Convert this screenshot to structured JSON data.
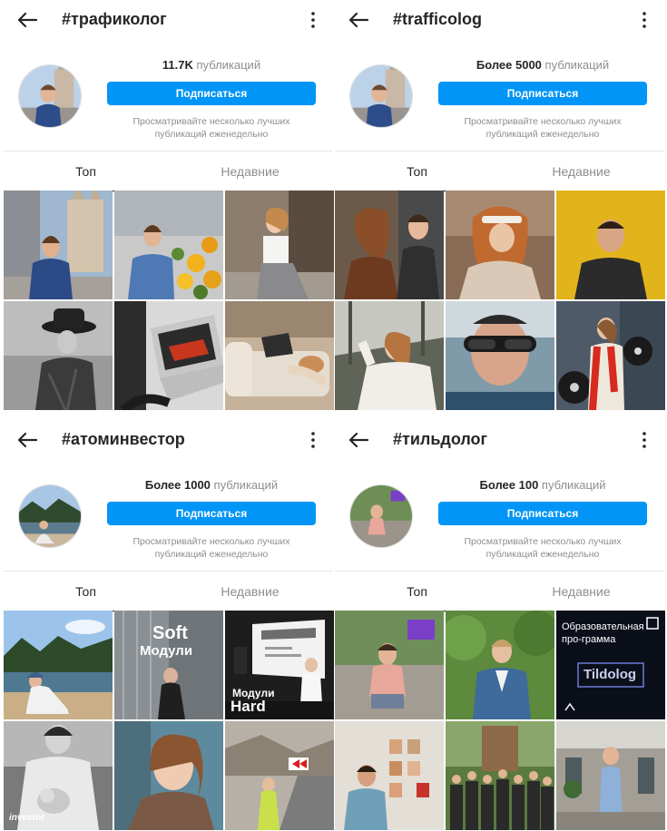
{
  "panels": [
    {
      "hashtag": "#трафиколог",
      "count_num": "11.7K",
      "count_label": "публикаций",
      "follow_label": "Подписаться",
      "desc_line1": "Просматривайте несколько лучших",
      "desc_line2": "публикаций еженедельно",
      "tab_top": "Топ",
      "tab_recent": "Недавние"
    },
    {
      "hashtag": "#trafficolog",
      "count_num": "Более 5000",
      "count_label": "публикаций",
      "follow_label": "Подписаться",
      "desc_line1": "Просматривайте несколько лучших",
      "desc_line2": "публикаций еженедельно",
      "tab_top": "Топ",
      "tab_recent": "Недавние"
    },
    {
      "hashtag": "#атоминвестор",
      "count_num": "Более 1000",
      "count_label": "публикаций",
      "follow_label": "Подписаться",
      "desc_line1": "Просматривайте несколько лучших",
      "desc_line2": "публикаций еженедельно",
      "tab_top": "Топ",
      "tab_recent": "Недавние",
      "post_texts": {
        "soft_title": "Soft",
        "soft_sub": "Модули",
        "hard_sub": "Модули",
        "hard_title": "Hard",
        "investor_tag": "investor"
      }
    },
    {
      "hashtag": "#тильдолог",
      "count_num": "Более 100",
      "count_label": "публикаций",
      "follow_label": "Подписаться",
      "desc_line1": "Просматривайте несколько лучших",
      "desc_line2": "публикаций еженедельно",
      "tab_top": "Топ",
      "tab_recent": "Недавние",
      "post_texts": {
        "edu_line1": "Образовательная",
        "edu_line2": "про-грамма",
        "edu_brand": "Tildolog"
      }
    }
  ],
  "icons": {
    "back": "arrow-left-icon",
    "more": "more-vertical-icon"
  },
  "colors": {
    "accent": "#0095f6",
    "text": "#262626",
    "muted": "#8e8e8e"
  }
}
